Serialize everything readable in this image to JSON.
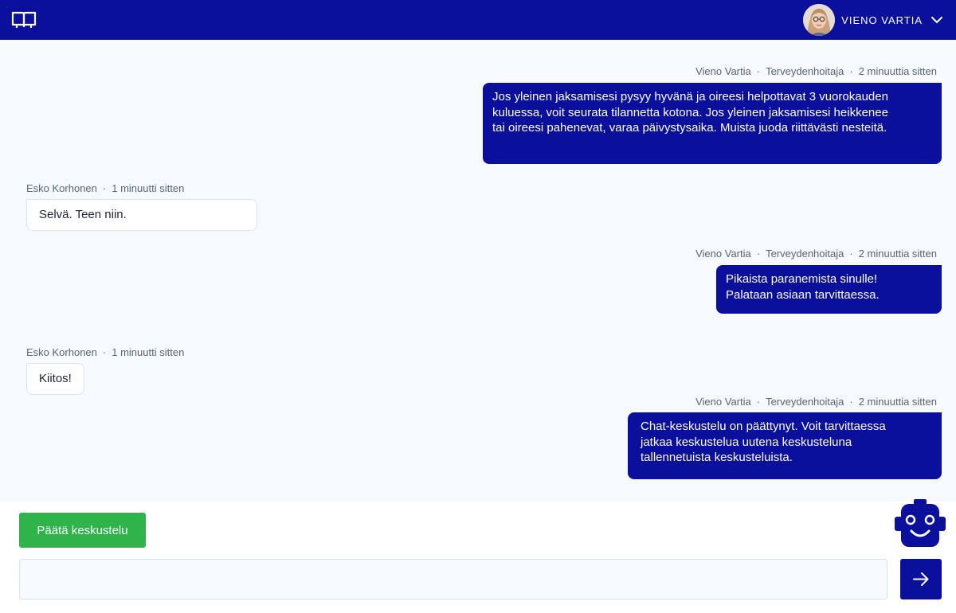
{
  "colors": {
    "brand": "#0a0f9c",
    "success": "#2eb44a",
    "conversation_bg": "#f6f9fd"
  },
  "header": {
    "logo_icon": "book-icon",
    "user_name": "VIENO VARTIA",
    "user_menu_icon": "chevron-down-icon"
  },
  "messages": [
    {
      "direction": "outgoing",
      "author": "Vieno Vartia",
      "role": "Terveydenhoitaja",
      "time": "2 minuuttia sitten",
      "lines": [
        "Jos yleinen jaksamisesi pysyy hyvänä ja oireesi helpottavat 3 vuorokauden",
        "kuluessa, voit seurata tilannetta kotona. Jos yleinen jaksamisesi heikkenee",
        "tai oireesi pahenevat, varaa päivystysaika. Muista juoda riittävästi nesteitä."
      ]
    },
    {
      "direction": "incoming",
      "author": "Esko Korhonen",
      "time": "1 minuutti sitten",
      "lines": [
        "Selvä. Teen niin."
      ]
    },
    {
      "direction": "outgoing",
      "author": "Vieno Vartia",
      "role": "Terveydenhoitaja",
      "time": "2 minuuttia sitten",
      "lines": [
        "Pikaista paranemista sinulle!",
        "Palataan asiaan tarvittaessa."
      ]
    },
    {
      "direction": "incoming",
      "author": "Esko Korhonen",
      "time": "1 minuutti sitten",
      "lines": [
        "Kiitos!"
      ]
    },
    {
      "direction": "outgoing",
      "author": "Vieno Vartia",
      "role": "Terveydenhoitaja",
      "time": "2 minuuttia sitten",
      "lines": [
        "Chat-keskustelu on päättynyt. Voit tarvittaessa",
        "jatkaa keskustelua uutena keskusteluna",
        "tallennetuista keskusteluista."
      ]
    }
  ],
  "meta_separator": "·",
  "composer": {
    "end_button_label": "Päätä keskustelu",
    "input_value": "",
    "input_placeholder": "",
    "send_icon": "arrow-right-icon",
    "assistant_icon": "robot-icon"
  }
}
